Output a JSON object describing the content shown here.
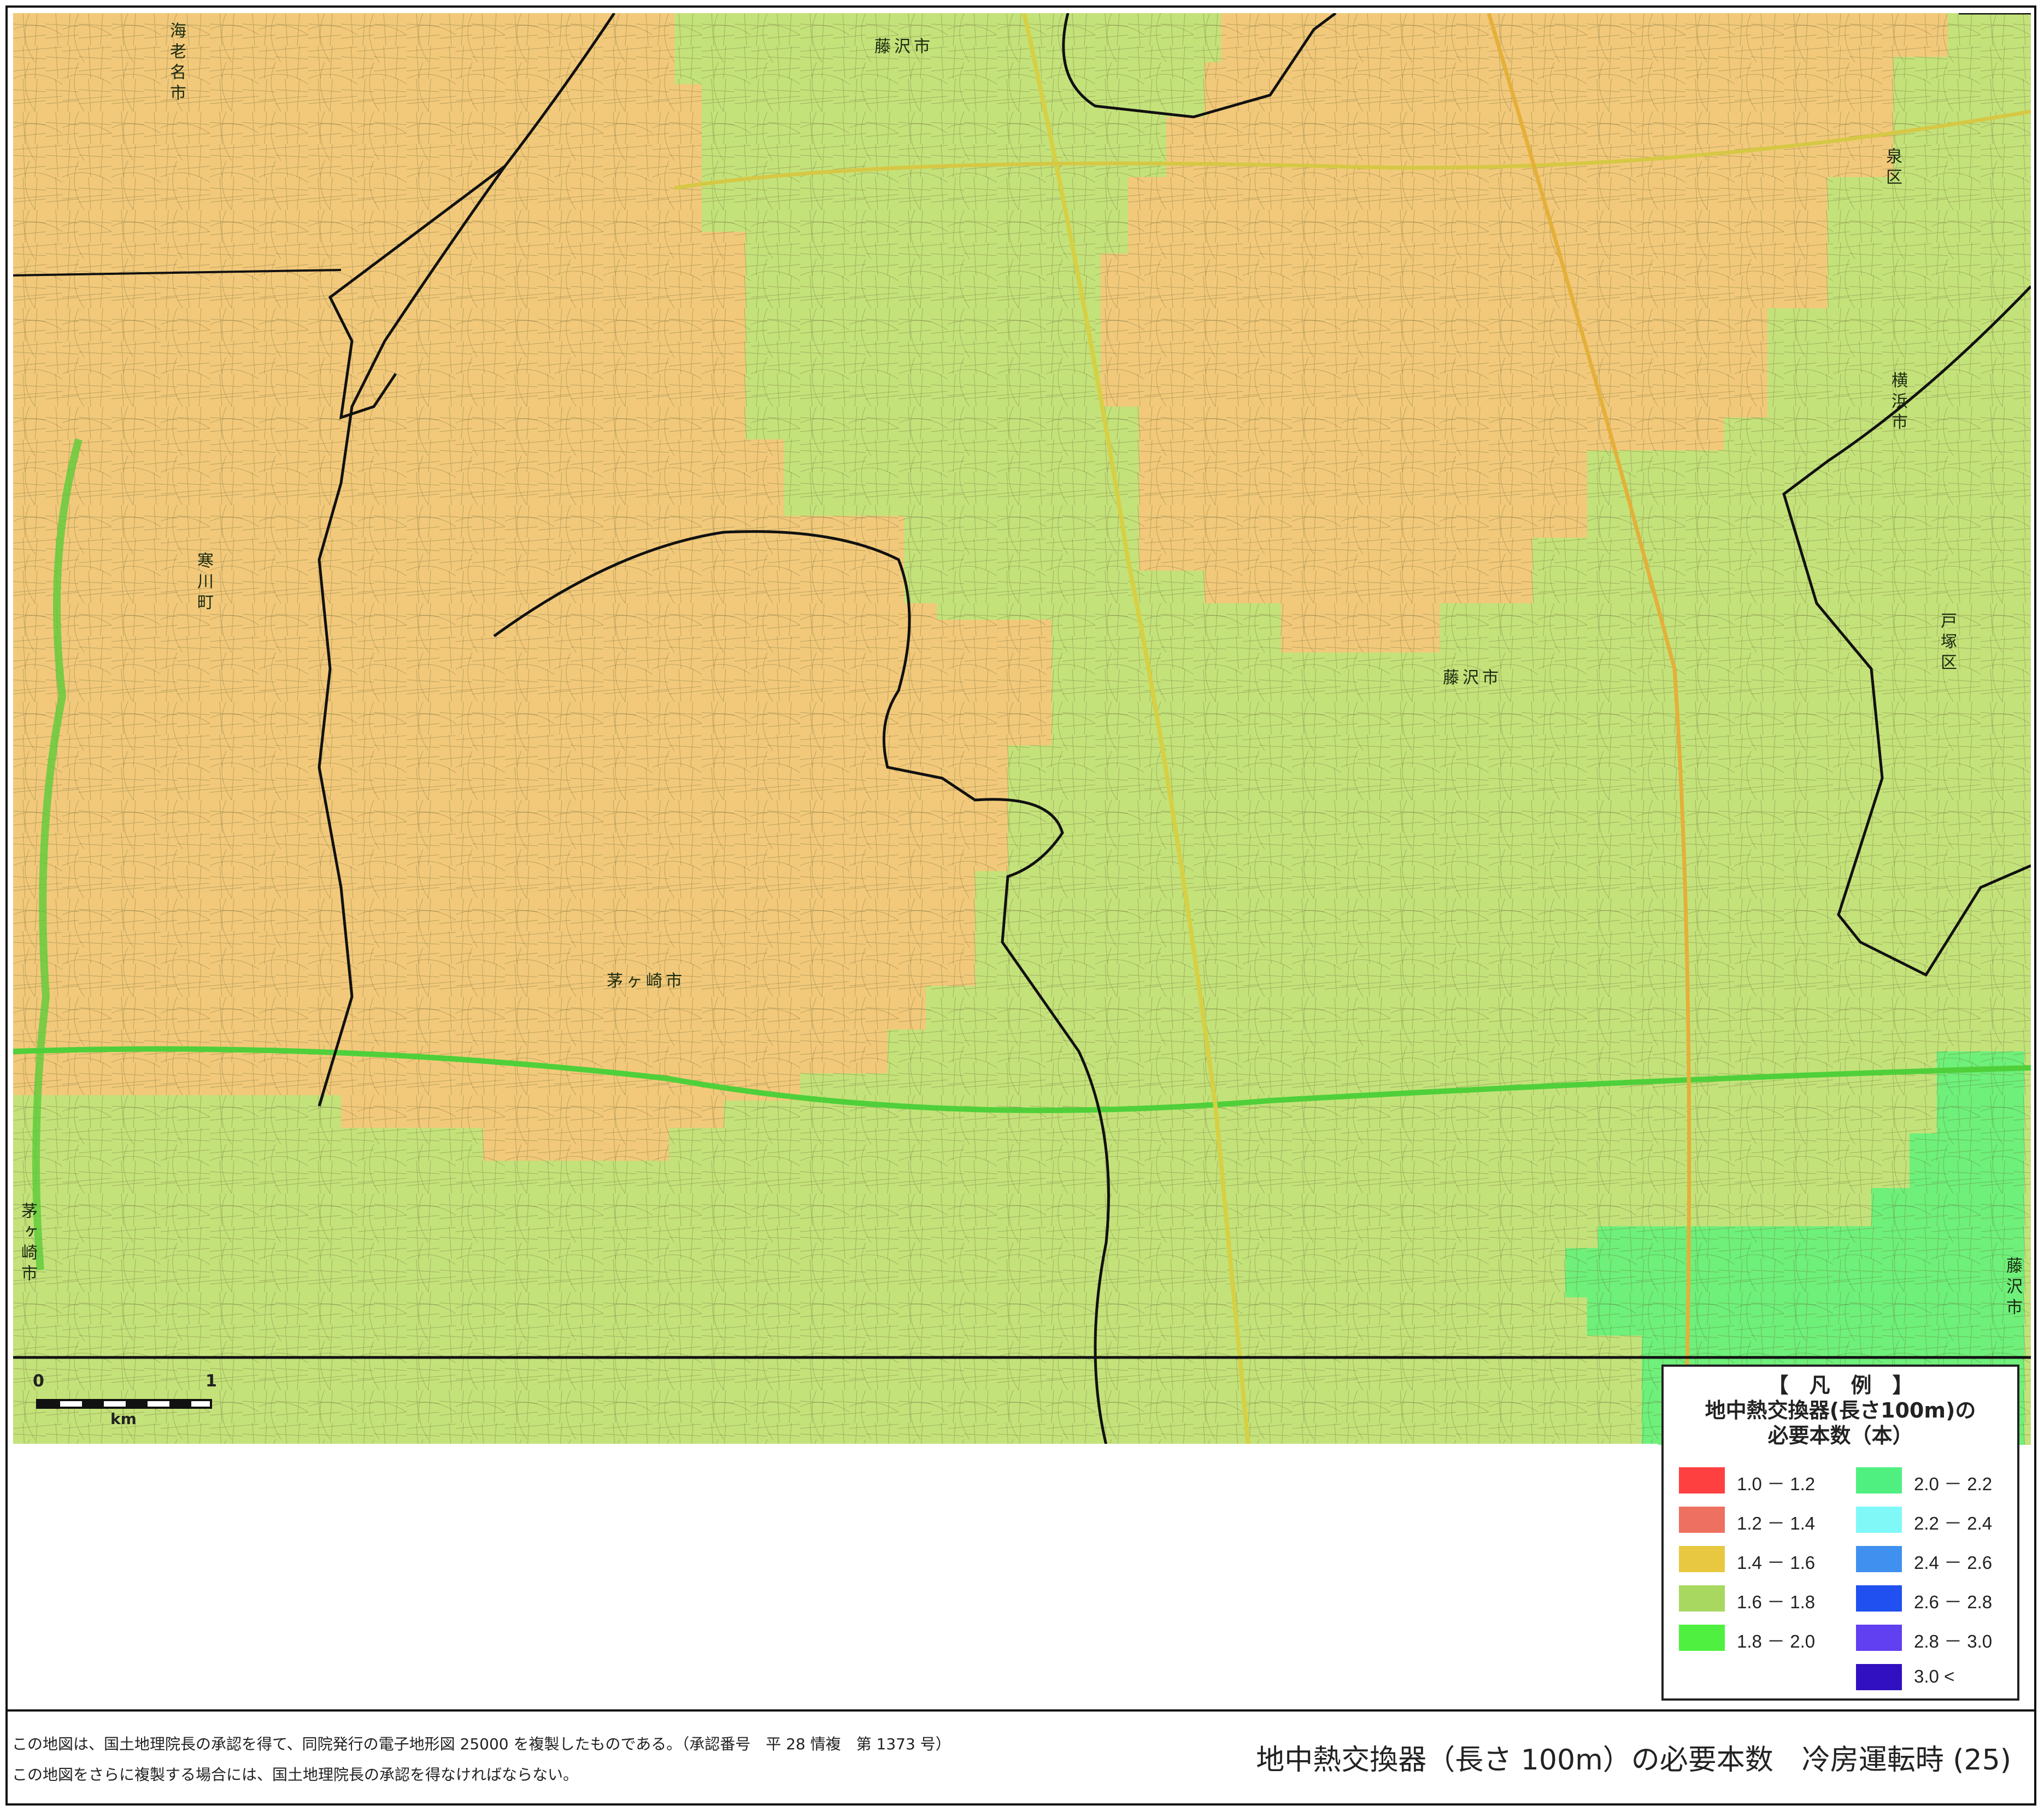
{
  "legend": {
    "heading": "【　凡　例　】",
    "title_line1": "地中熱交換器(長さ100m)の",
    "title_line2": "必要本数（本）",
    "items": [
      {
        "label": "1.0 － 1.2",
        "color": "#ff4040"
      },
      {
        "label": "1.2 － 1.4",
        "color": "#ee7060"
      },
      {
        "label": "1.4 － 1.6",
        "color": "#e8c840"
      },
      {
        "label": "1.6 － 1.8",
        "color": "#a8d860"
      },
      {
        "label": "1.8 － 2.0",
        "color": "#50f040"
      },
      {
        "label": "2.0 － 2.2",
        "color": "#50f080"
      },
      {
        "label": "2.2 － 2.4",
        "color": "#80f8f8"
      },
      {
        "label": "2.4 － 2.6",
        "color": "#4090f0"
      },
      {
        "label": "2.6 － 2.8",
        "color": "#2050f0"
      },
      {
        "label": "2.8 － 3.0",
        "color": "#6040f0"
      },
      {
        "label": "3.0 <",
        "color": "#3010c0"
      }
    ]
  },
  "places": {
    "ebina": "海老名市",
    "samukawa": "寒川町",
    "chigasaki": "茅ヶ崎市",
    "chigasaki_left": "茅ヶ崎市",
    "fujisawa_top": "藤沢市",
    "fujisawa_center": "藤沢市",
    "fujisawa_right": "藤沢市",
    "izumi": "泉区",
    "yokohama": "横浜市",
    "totsuka": "戸塚区"
  },
  "scale": {
    "start": "0",
    "end": "1",
    "unit": "km"
  },
  "footer": {
    "note1": "この地図は、国土地理院長の承認を得て、同院発行の電子地形図 25000 を複製したものである。（承認番号　平 28 情複　第 1373 号）",
    "note2": "この地図をさらに複製する場合には、国土地理院長の承認を得なければならない。",
    "title": "地中熱交換器（長さ 100m）の必要本数　冷房運転時 (25)"
  },
  "map_colors": {
    "zone_1_4_1_6": "#f2c97a",
    "zone_1_6_1_8": "#c4e27a",
    "zone_1_8_2_0": "#6ef07a"
  }
}
